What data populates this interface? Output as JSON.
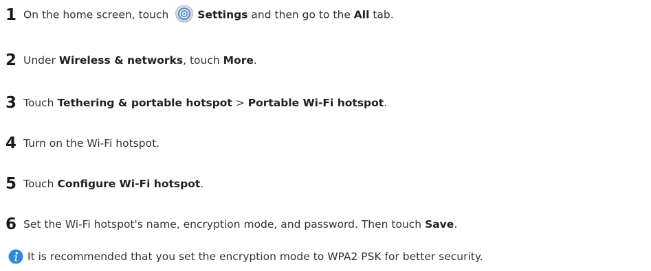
{
  "steps": [
    {
      "number": "1",
      "parts": [
        "On the home screen, touch",
        "Settings",
        "and then go to the",
        "All",
        "tab."
      ],
      "icon": "settings-gear-icon"
    },
    {
      "number": "2",
      "parts": [
        "Under",
        "Wireless & networks",
        ", touch",
        "More",
        "."
      ]
    },
    {
      "number": "3",
      "parts": [
        "Touch",
        "Tethering & portable hotspot",
        ">",
        "Portable Wi-Fi hotspot",
        "."
      ]
    },
    {
      "number": "4",
      "parts": [
        "Turn on the Wi-Fi hotspot."
      ]
    },
    {
      "number": "5",
      "parts": [
        "Touch",
        "Configure Wi-Fi hotspot",
        "."
      ]
    },
    {
      "number": "6",
      "parts": [
        "Set the Wi-Fi hotspot's name, encryption mode, and password. Then touch",
        "Save",
        "."
      ]
    }
  ],
  "note": {
    "icon": "info-icon",
    "text": "It is recommended that you set the encryption mode to WPA2 PSK for better security."
  },
  "colors": {
    "text": "#333333",
    "info_icon": "#2e8ad8",
    "settings_icon": "#5b8fcf"
  }
}
